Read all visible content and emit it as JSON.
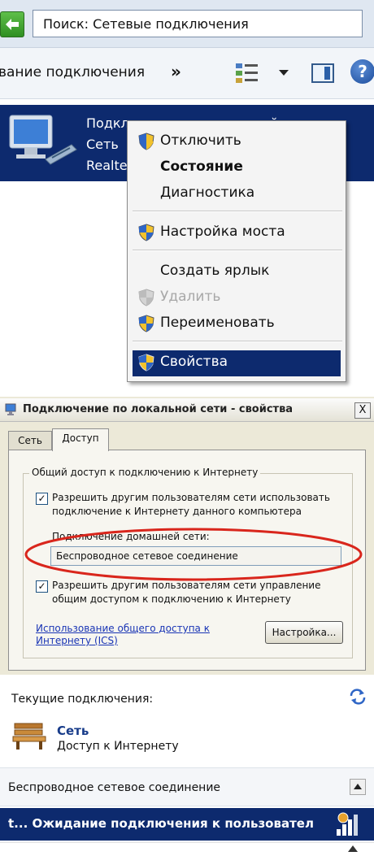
{
  "explorer": {
    "search_text": "Поиск: Сетевые подключения",
    "toolbar_label": "вание подключения",
    "toolbar_more": "»",
    "connection": {
      "name": "Подключение по локальной сети",
      "status": "Сеть",
      "adapter": "Realtek"
    },
    "context_menu": [
      {
        "label": "Отключить",
        "style": "normal",
        "icon": "shield-icon"
      },
      {
        "label": "Состояние",
        "style": "bold",
        "icon": ""
      },
      {
        "label": "Диагностика",
        "style": "normal",
        "icon": ""
      },
      {
        "label": "Настройка моста",
        "style": "normal",
        "icon": "shield-icon"
      },
      {
        "label": "Создать ярлык",
        "style": "normal",
        "icon": ""
      },
      {
        "label": "Удалить",
        "style": "disabled",
        "icon": "shield-icon"
      },
      {
        "label": "Переименовать",
        "style": "normal",
        "icon": "shield-icon"
      },
      {
        "label": "Свойства",
        "style": "selected",
        "icon": "shield-icon"
      }
    ]
  },
  "dialog": {
    "title": "Подключение по локальной сети - свойства",
    "close": "X",
    "tabs": [
      "Сеть",
      "Доступ"
    ],
    "group_title": "Общий доступ к подключению к Интернету",
    "allow_share_line1": "Разрешить другим пользователям сети использовать",
    "allow_share_line2": "подключение к Интернету данного компьютера",
    "home_label": "Подключение домашней сети:",
    "home_value": "Беспроводное сетевое соединение",
    "allow_control_line1": "Разрешить другим пользователям сети управление",
    "allow_control_line2": "общим доступом к подключению к Интернету",
    "ics_link_line1": "Использование общего доступа к",
    "ics_link_line2": "Интернету (ICS)",
    "setup_button": "Настройка...",
    "check_mark": "✓"
  },
  "flyout": {
    "current_label": "Текущие подключения:",
    "network_name": "Сеть",
    "network_access": "Доступ к Интернету",
    "wireless_label": "Беспроводное сетевое соединение",
    "waiting_label": "t...   Ожидание подключения к пользовател"
  },
  "colors": {
    "selection_blue": "#0d2a6e",
    "annotation_red": "#d9261c",
    "link_blue": "#1a35b5"
  }
}
